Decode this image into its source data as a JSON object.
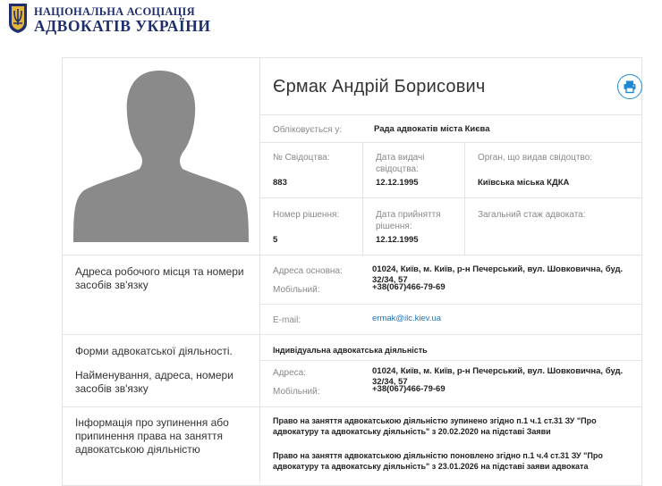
{
  "header": {
    "org_line1": "НАЦІОНАЛЬНА АСОЦІАЦІЯ",
    "org_line2": "АДВОКАТІВ УКРАЇНИ"
  },
  "profile": {
    "name": "Єрмак Андрій Борисович",
    "registered_label": "Обліковується у:",
    "registered_value": "Рада адвокатів міста Києва",
    "certificate_no_label": "№ Свідоцтва:",
    "certificate_no_value": "883",
    "issue_date_label": "Дата видачі свідоцтва:",
    "issue_date_value": "12.12.1995",
    "issuer_label": "Орган, що видав свідоцтво:",
    "issuer_value": "Київська міська КДКА",
    "decision_no_label": "Номер рішення:",
    "decision_no_value": "5",
    "decision_date_label": "Дата прийняття рішення:",
    "decision_date_value": "12.12.1995",
    "experience_label": "Загальний стаж адвоката:"
  },
  "workplace": {
    "title": "Адреса робочого місця та номери засобів зв'язку",
    "address_label": "Адреса основна:",
    "address_value": "01024, Київ, м. Київ, р-н Печерський, вул. Шовковична, буд. 32/34, 57",
    "mobile_label": "Мобільний:",
    "mobile_value": "+38(067)466-79-69",
    "email_label": "E-mail:",
    "email_value": "ermak@ilc.kiev.ua"
  },
  "practice": {
    "title": "Форми адвокатської діяльності.",
    "subtitle": "Найменування, адреса, номери засобів зв'язку",
    "form_value": "Індивідуальна адвокатська діяльність",
    "address_label": "Адреса:",
    "address_value": "01024, Київ, м. Київ, р-н Печерський, вул. Шовковична, буд. 32/34, 57",
    "mobile_label": "Мобільний:",
    "mobile_value": "+38(067)466-79-69"
  },
  "suspension": {
    "title": "Інформація про зупинення або припинення права на заняття адвокатською діяльністю",
    "entry1": "Право на заняття адвокатською діяльністю зупинено згідно п.1 ч.1 ст.31 ЗУ \"Про адвокатуру та адвокатську діяльність\" з 20.02.2020 на підставі Заяви",
    "entry2": "Право на заняття адвокатською діяльністю поновлено згідно п.1 ч.4 ст.31 ЗУ \"Про адвокатуру та адвокатську діяльність\" з 23.01.2026 на підставі заяви адвоката"
  },
  "icons": {
    "logo": "trident-emblem",
    "print": "print-icon",
    "avatar": "person-silhouette"
  },
  "colors": {
    "brand": "#1f2f6e",
    "accent": "#1e88d4",
    "link": "#1e73be",
    "border": "#e4e4e4"
  }
}
